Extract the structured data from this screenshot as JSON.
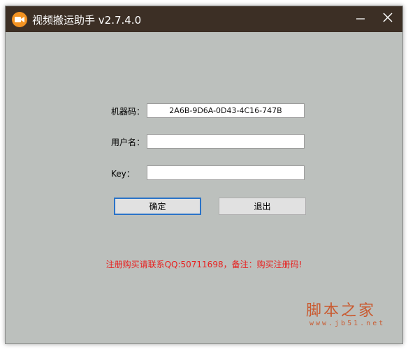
{
  "window": {
    "title": "视频搬运助手 v2.7.4.0",
    "icons": {
      "app": "video-camera-icon",
      "minimize": "minimize-icon",
      "close": "close-icon"
    },
    "colors": {
      "titlebar": "#3c2f25",
      "app_icon": "#f39322",
      "body": "#bcc0bd",
      "notice": "#e8201f",
      "primary_border": "#2a73c8"
    }
  },
  "form": {
    "machine_code_label": "机器码：",
    "machine_code_value": "2A6B-9D6A-0D43-4C16-747B",
    "username_label": "用户名：",
    "username_value": "",
    "key_label": "Key：",
    "key_value": ""
  },
  "buttons": {
    "ok": "确定",
    "exit": "退出"
  },
  "notice": "注册购买请联系QQ:50711698，备注：购买注册码!",
  "watermark": {
    "logo": "脚本之家",
    "url": "www.jb51.net"
  }
}
